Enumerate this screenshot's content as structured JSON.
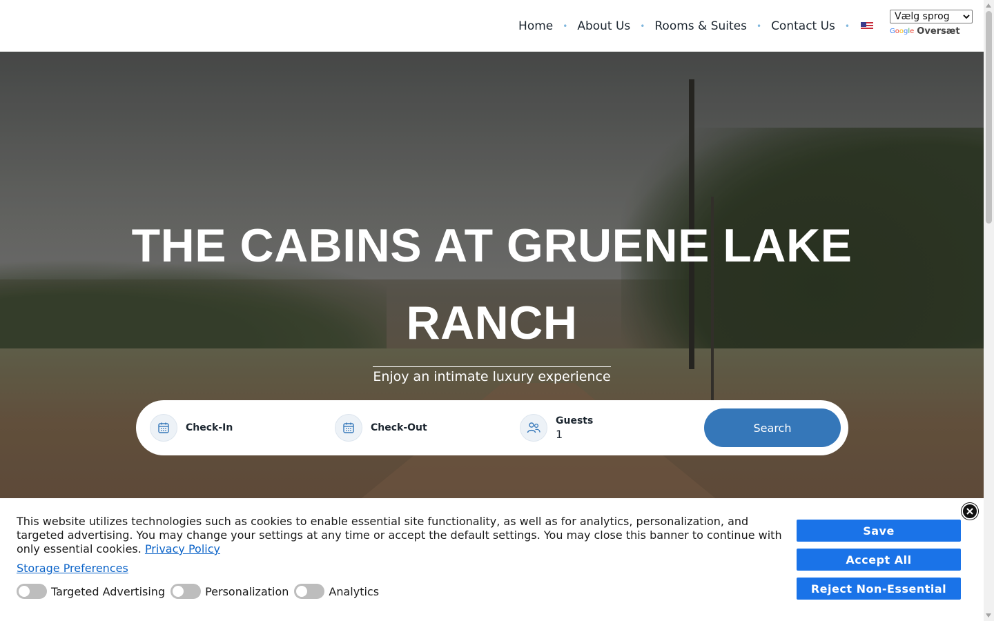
{
  "nav": {
    "items": [
      {
        "label": "Home"
      },
      {
        "label": "About Us"
      },
      {
        "label": "Rooms & Suites"
      },
      {
        "label": "Contact Us"
      }
    ],
    "separator": "•",
    "flag_icon": "us-flag-icon"
  },
  "translate": {
    "select_value": "Vælg sprog",
    "google_label": "Google",
    "translate_label": "Oversæt"
  },
  "hero": {
    "title": "THE CABINS AT GRUENE LAKE RANCH",
    "subtitle": "Enjoy an intimate luxury experience"
  },
  "booking": {
    "checkin_label": "Check-In",
    "checkout_label": "Check-Out",
    "guests_label": "Guests",
    "guests_value": "1",
    "search_label": "Search",
    "accent_color": "#3577b9"
  },
  "cookie": {
    "text": "This website utilizes technologies such as cookies to enable essential site functionality, as well as for analytics, personalization, and targeted advertising. You may change your settings at any time or accept the default settings. You may close this banner to continue with only essential cookies.",
    "privacy_link": "Privacy Policy",
    "storage_link": "Storage Preferences",
    "toggles": [
      {
        "label": "Targeted Advertising",
        "on": false
      },
      {
        "label": "Personalization",
        "on": false
      },
      {
        "label": "Analytics",
        "on": false
      }
    ],
    "save_label": "Save",
    "accept_label": "Accept All",
    "reject_label": "Reject Non-Essential",
    "button_color": "#1a73e8"
  }
}
